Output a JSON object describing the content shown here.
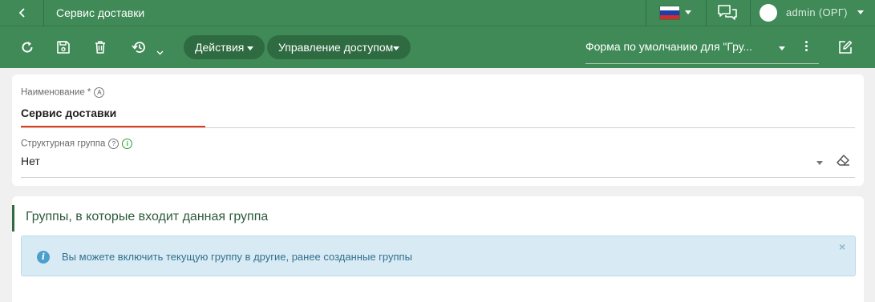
{
  "header": {
    "title": "Сервис доставки",
    "user": "admin (ОРГ)",
    "language_flag": "russia-flag-icon"
  },
  "toolbar": {
    "actions_label": "Действия",
    "access_label": "Управление доступом",
    "form_label": "Форма по умолчанию для \"Гру..."
  },
  "form": {
    "name_label": "Наименование *",
    "name_value": "Сервис доставки",
    "group_label": "Структурная группа",
    "group_value": "Нет"
  },
  "section": {
    "title": "Группы, в которые входит данная группа",
    "info_text": "Вы можете включить текущую группу в другие, ранее созданные группы"
  },
  "colors": {
    "header_bg": "#3f8a56",
    "pill_bg": "#2f6b41",
    "accent_red": "#e23d1b",
    "info_bg": "#d8ebf4"
  }
}
